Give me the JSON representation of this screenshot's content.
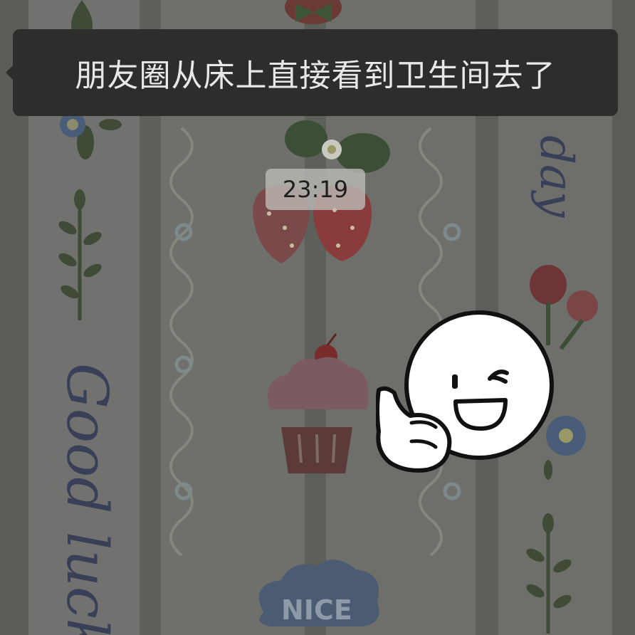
{
  "chat": {
    "message_text": "朋友圈从床上直接看到卫生间去了",
    "timestamp": "23:19"
  },
  "wallpaper": {
    "script_left": "Good luck",
    "script_right": "day",
    "cloud_text": "NICE"
  },
  "sticker": {
    "name": "thumbs-up-smiley-sticker"
  },
  "colors": {
    "bubble": "#2d2d2c",
    "bubble_text": "#e8e8e6",
    "time_badge": "#bebeb9",
    "wallpaper_base": "#6b6c66"
  }
}
